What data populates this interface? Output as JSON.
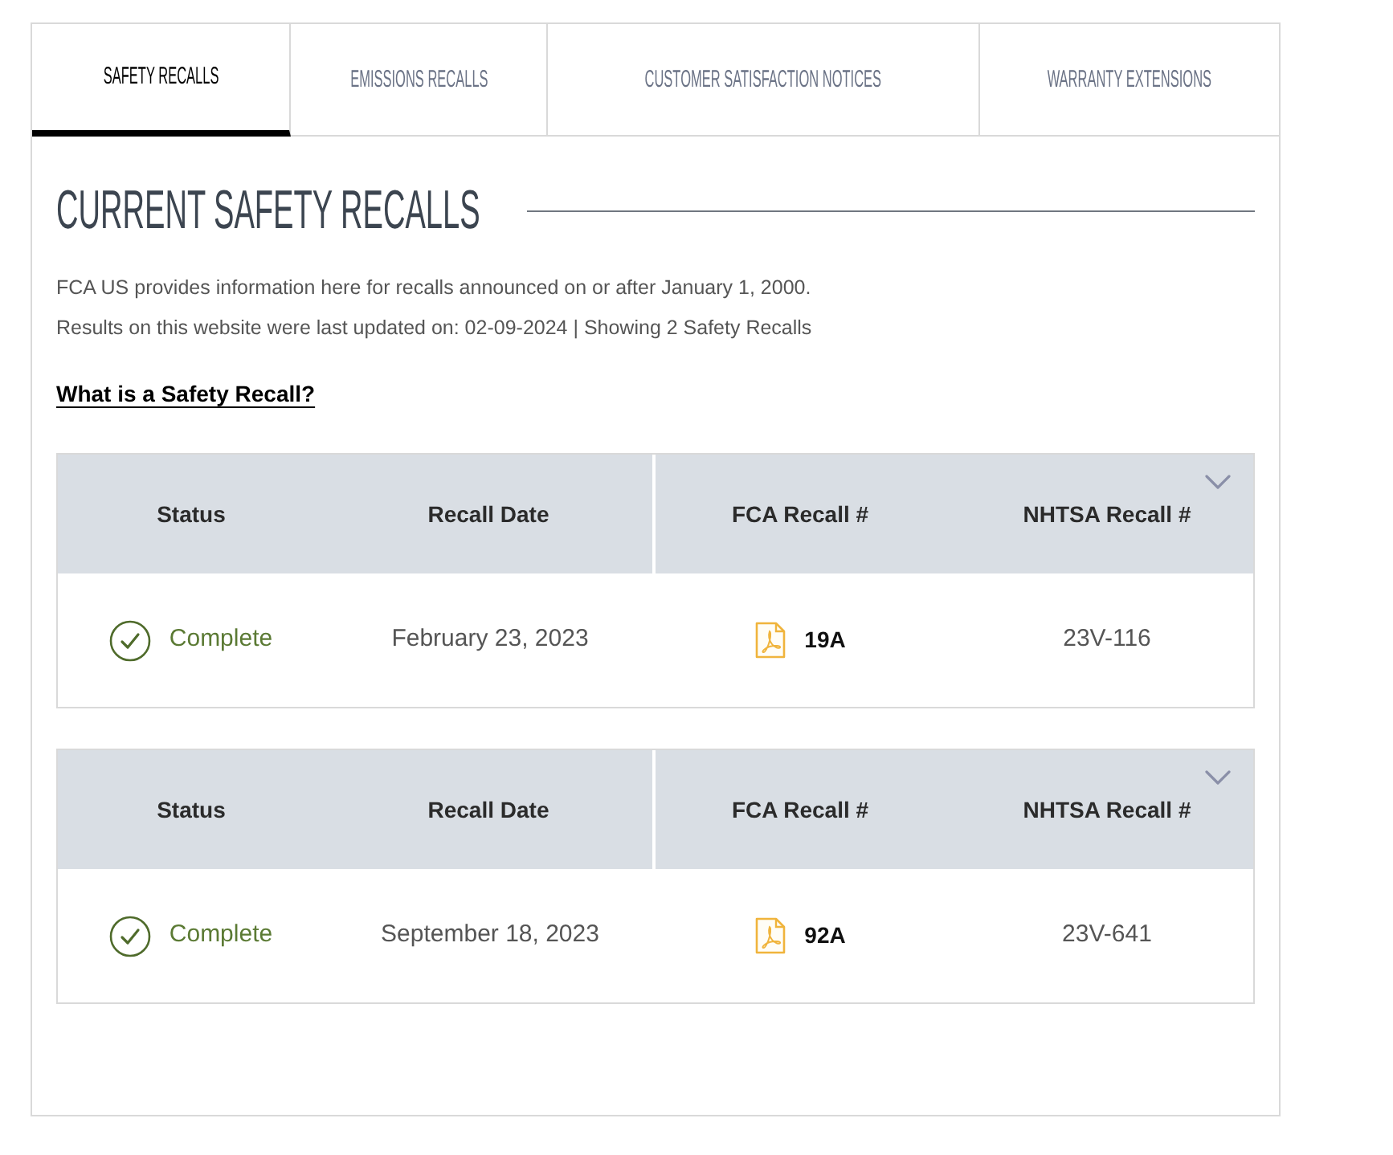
{
  "tabs": [
    {
      "label": "SAFETY RECALLS",
      "selected": true
    },
    {
      "label": "EMISSIONS RECALLS",
      "selected": false
    },
    {
      "label": "CUSTOMER SATISFACTION NOTICES",
      "selected": false
    },
    {
      "label": "WARRANTY EXTENSIONS",
      "selected": false
    }
  ],
  "section": {
    "title": "CURRENT SAFETY RECALLS",
    "intro": "FCA US provides information here for recalls announced on or after January 1, 2000.",
    "update_note": "Results on this website were last updated on: 02-09-2024 | Showing 2 Safety Recalls",
    "link": "What is a Safety Recall?"
  },
  "recalls": [
    {
      "expanded": false,
      "columns": [
        "Status",
        "Recall Date",
        "FCA Recall #",
        "NHTSA Recall #"
      ],
      "status": "Complete",
      "recall_date": "February 23, 2023",
      "fca_recall": "19A",
      "nhtsa_recall": "23V-116"
    },
    {
      "expanded": false,
      "columns": [
        "Status",
        "Recall Date",
        "FCA Recall #",
        "NHTSA Recall #"
      ],
      "status": "Complete",
      "recall_date": "September 18, 2023",
      "fca_recall": "92A",
      "nhtsa_recall": "23V-641"
    }
  ]
}
